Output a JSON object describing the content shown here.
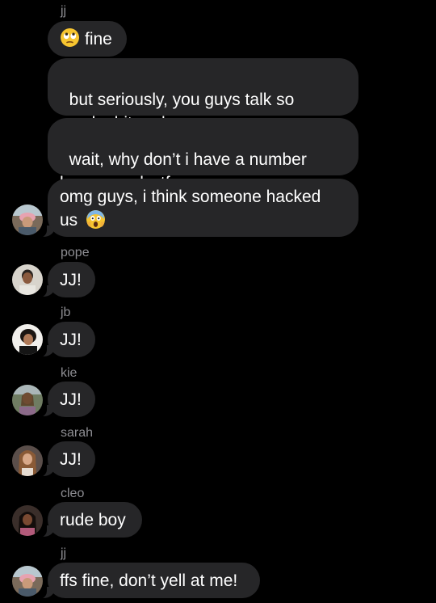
{
  "messages": {
    "g1": {
      "sender": "jj",
      "bubbles": [
        {
          "text": "fine",
          "emoji": "face-with-rolling-eyes-icon"
        },
        {
          "text": "but seriously, you guys talk so\nmuch shit and"
        },
        {
          "text": "wait, why don’t i have a number\nhere saved wtf"
        },
        {
          "text": "omg guys, i think someone hacked\nus",
          "emoji": "face-screaming-in-fear-icon"
        }
      ]
    },
    "g2": {
      "sender": "pope",
      "text": "JJ!"
    },
    "g3": {
      "sender": "jb",
      "text": "JJ!"
    },
    "g4": {
      "sender": "kie",
      "text": "JJ!"
    },
    "g5": {
      "sender": "sarah",
      "text": "JJ!"
    },
    "g6": {
      "sender": "cleo",
      "text": "rude boy"
    },
    "g7": {
      "sender": "jj",
      "text": "ffs fine, don’t yell at me!"
    }
  },
  "colors": {
    "background": "#000000",
    "bubble": "#262628",
    "sender_label": "#8e8e93",
    "text": "#ffffff"
  }
}
